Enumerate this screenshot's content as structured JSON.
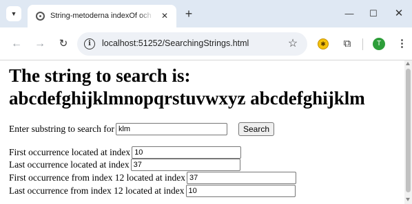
{
  "browser": {
    "tab_title": "String-metoderna indexOf och lastIndexOf",
    "url": "localhost:51252/SearchingStrings.html",
    "profile_initial": "T"
  },
  "page": {
    "heading_line1": "The string to search is:",
    "heading_line2": "abcdefghijklmnopqrstuvwxyz abcdefghijklm",
    "search_label": "Enter substring to search for",
    "search_value": "klm",
    "search_button": "Search",
    "results": [
      {
        "label": "First occurrence located at index",
        "value": "10"
      },
      {
        "label": "Last occurrence located at index",
        "value": "37"
      },
      {
        "label": "First occurrence from index 12 located at index",
        "value": "37"
      },
      {
        "label": "Last occurrence from index 12 located at index",
        "value": "10"
      }
    ]
  }
}
